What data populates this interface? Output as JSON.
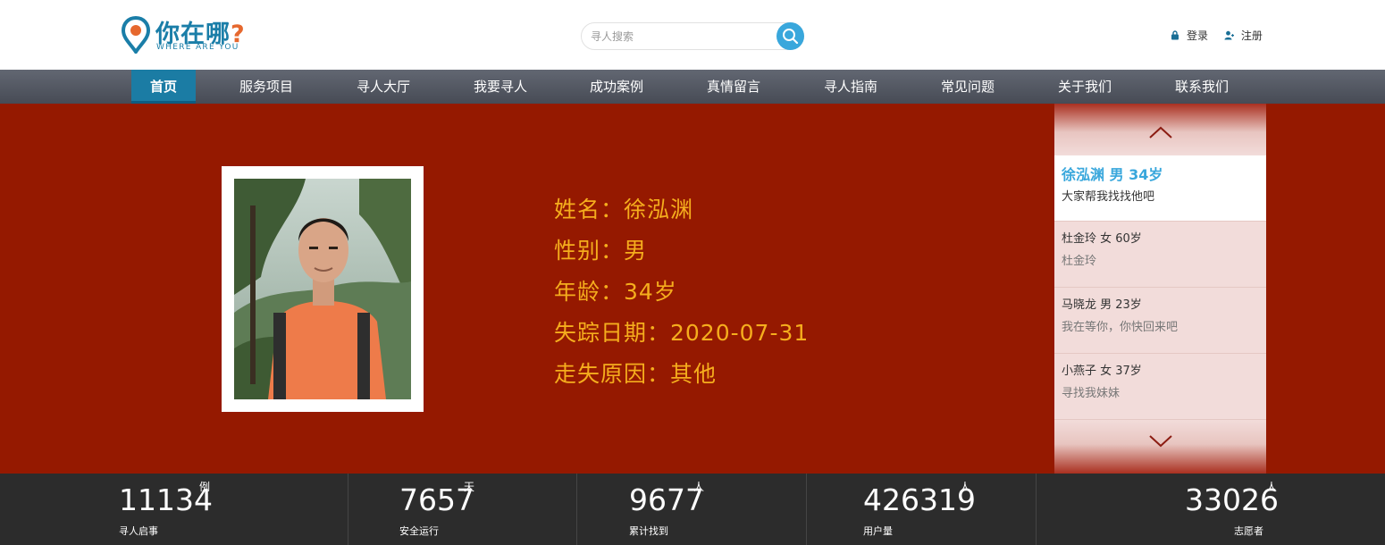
{
  "brand": {
    "name_cn_main": "你在哪",
    "name_cn_mark": "?",
    "name_en": "WHERE ARE YOU",
    "colors": {
      "primary": "#1a7ea8",
      "accent": "#e6682e"
    }
  },
  "search": {
    "placeholder": "寻人搜索",
    "value": "",
    "button_icon": "search-icon"
  },
  "auth": {
    "login_label": "登录",
    "register_label": "注册"
  },
  "nav": {
    "items": [
      {
        "label": "首页",
        "active": true
      },
      {
        "label": "服务项目"
      },
      {
        "label": "寻人大厅"
      },
      {
        "label": "我要寻人"
      },
      {
        "label": "成功案例"
      },
      {
        "label": "真情留言"
      },
      {
        "label": "寻人指南"
      },
      {
        "label": "常见问题"
      },
      {
        "label": "关于我们"
      },
      {
        "label": "联系我们"
      }
    ]
  },
  "featured": {
    "name_line": "姓名：徐泓渊",
    "gender_line": "性别：男",
    "age_line": "年龄：34岁",
    "missing_date_line": "失踪日期：2020-07-31",
    "reason_line": "走失原因：其他",
    "text_color": "#f5ad1d",
    "background_color": "#951900"
  },
  "side_list": {
    "up_icon": "chevron-up-icon",
    "down_icon": "chevron-down-icon",
    "items": [
      {
        "title": "徐泓渊 男 34岁",
        "subtitle": "大家帮我找找他吧",
        "active": true
      },
      {
        "title": "杜金玲 女 60岁",
        "subtitle": "杜金玲"
      },
      {
        "title": "马晓龙 男 23岁",
        "subtitle": "我在等你，你快回来吧"
      },
      {
        "title": "小燕子 女 37岁",
        "subtitle": "寻找我妹妹"
      }
    ]
  },
  "stats": [
    {
      "value": "11134",
      "unit": "例",
      "label": "寻人启事"
    },
    {
      "value": "7657",
      "unit": "天",
      "label": "安全运行"
    },
    {
      "value": "9677",
      "unit": "人",
      "label": "累计找到"
    },
    {
      "value": "426319",
      "unit": "人",
      "label": "用户量"
    },
    {
      "value": "33026",
      "unit": "人",
      "label": "志愿者"
    }
  ]
}
